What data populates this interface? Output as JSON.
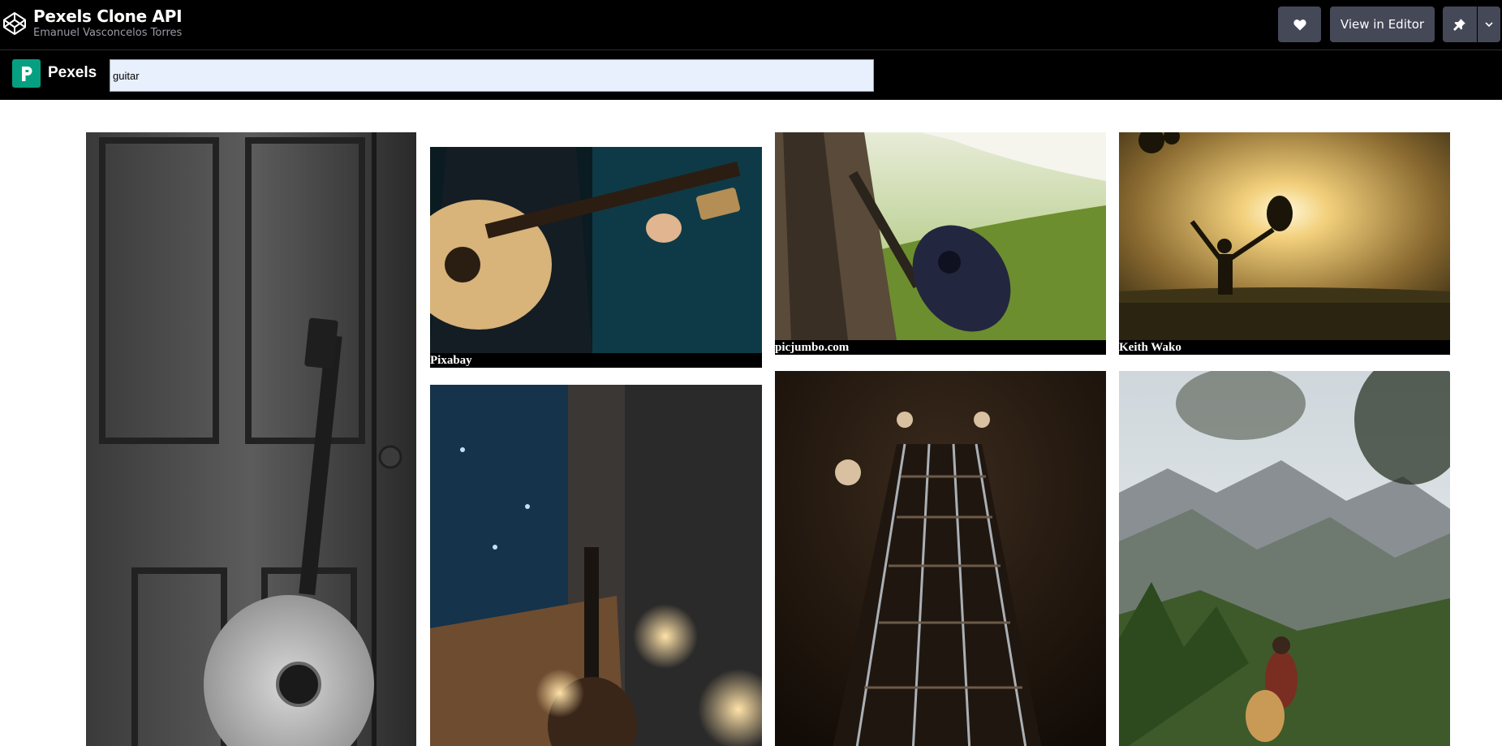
{
  "codepen": {
    "title": "Pexels Clone API",
    "author": "Emanuel Vasconcelos Torres",
    "heart_icon": "heart-icon",
    "view_in_editor_label": "View in Editor",
    "pin_icon": "pin-icon",
    "caret_icon": "chevron-down-icon"
  },
  "app": {
    "brand": "Pexels",
    "brand_color": "#05a081",
    "search": {
      "value": "guitar",
      "placeholder": ""
    }
  },
  "photos": [
    {
      "alt": "acoustic guitar leaning on wooden door, black and white",
      "credit": ""
    },
    {
      "alt": "person in leather jacket playing acoustic guitar",
      "credit": "Pixabay"
    },
    {
      "alt": "acoustic guitar leaning on tree trunk in grass",
      "credit": "picjumbo.com"
    },
    {
      "alt": "silhouette holding guitar up against sun",
      "credit": "Keith Wako"
    },
    {
      "alt": "guitar near window with warm lights",
      "credit": ""
    },
    {
      "alt": "guitar fretboard close-up perspective",
      "credit": ""
    },
    {
      "alt": "person with guitar overlooking mountain valley",
      "credit": ""
    }
  ]
}
